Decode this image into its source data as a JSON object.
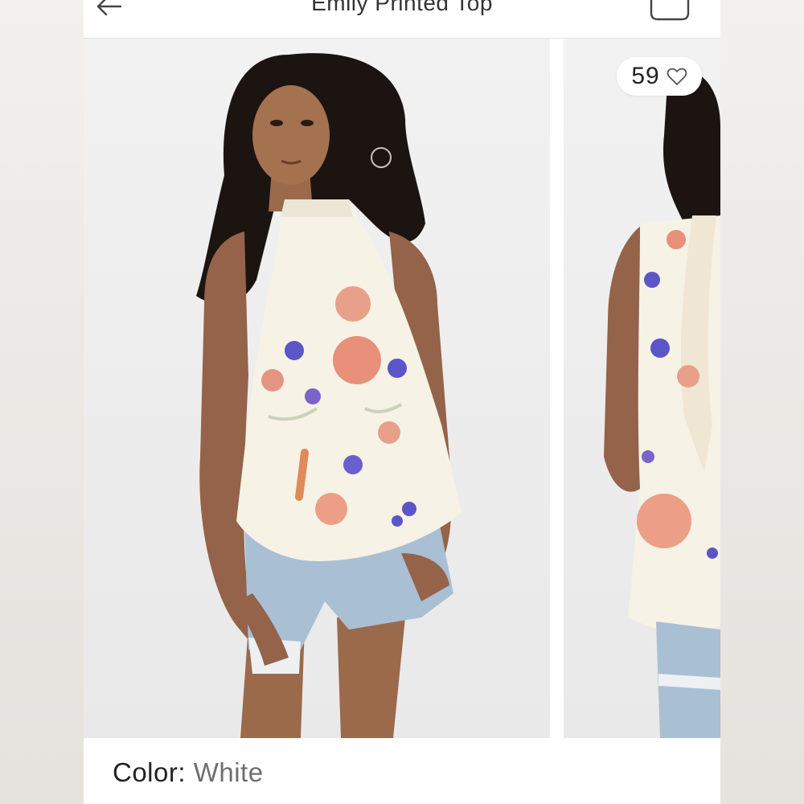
{
  "header": {
    "title": "Emily Printed Top",
    "back_icon": "arrow-left-icon",
    "bag_icon": "shopping-bag-icon"
  },
  "gallery": {
    "likes": "59",
    "like_icon": "heart-outline-icon",
    "images": [
      {
        "alt": "model-front-view"
      },
      {
        "alt": "model-back-view"
      }
    ]
  },
  "details": {
    "color_label": "Color: ",
    "color_value": "White"
  },
  "colors": {
    "top_fabric": "#f6f2e6",
    "floral_pink": "#e8907a",
    "floral_blue": "#5b55c7",
    "denim": "#a9bfd4",
    "skin": "#9a6a4a",
    "hair": "#1c1410"
  }
}
